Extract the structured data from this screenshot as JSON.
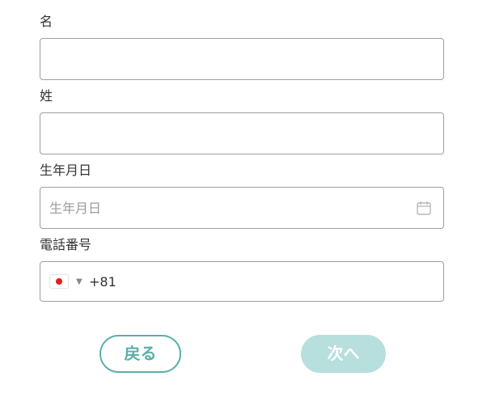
{
  "form": {
    "first_name": {
      "label": "名",
      "value": "",
      "placeholder": ""
    },
    "last_name": {
      "label": "姓",
      "value": "",
      "placeholder": ""
    },
    "birthdate": {
      "label": "生年月日",
      "value": "",
      "placeholder": "生年月日",
      "icon": "calendar-icon"
    },
    "phone": {
      "label": "電話番号",
      "country_code": "+81",
      "country_flag": "japan-flag-icon",
      "value": "+81"
    }
  },
  "buttons": {
    "back_label": "戻る",
    "next_label": "次へ"
  },
  "colors": {
    "accent": "#5aafa8",
    "accent_disabled": "#b7dfdd",
    "border": "#9e9e9e",
    "text": "#333333",
    "placeholder": "#9a9a9a",
    "flag_red": "#e0201f"
  }
}
